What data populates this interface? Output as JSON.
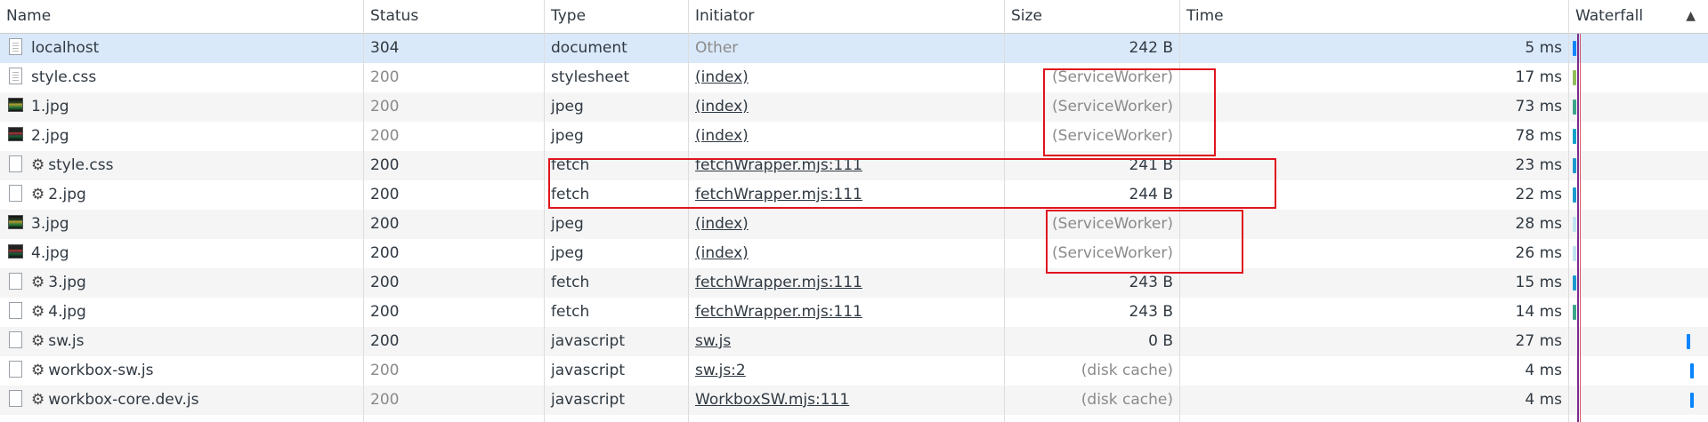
{
  "columns": {
    "name": "Name",
    "status": "Status",
    "type": "Type",
    "initiator": "Initiator",
    "size": "Size",
    "time": "Time",
    "waterfall": "Waterfall"
  },
  "rows": [
    {
      "name": "localhost",
      "icon": "document-icon",
      "gear": false,
      "status": "304",
      "status_muted": false,
      "type": "document",
      "initiator": "Other",
      "initiator_link": false,
      "size": "242 B",
      "size_muted": false,
      "time": "5 ms",
      "selected": true
    },
    {
      "name": "style.css",
      "icon": "document-icon",
      "gear": false,
      "status": "200",
      "status_muted": true,
      "type": "stylesheet",
      "initiator": "(index)",
      "initiator_link": true,
      "size": "(ServiceWorker)",
      "size_muted": true,
      "time": "17 ms"
    },
    {
      "name": "1.jpg",
      "icon": "image-icon",
      "gear": false,
      "status": "200",
      "status_muted": true,
      "type": "jpeg",
      "initiator": "(index)",
      "initiator_link": true,
      "size": "(ServiceWorker)",
      "size_muted": true,
      "time": "73 ms"
    },
    {
      "name": "2.jpg",
      "icon": "image-icon",
      "gear": false,
      "status": "200",
      "status_muted": true,
      "type": "jpeg",
      "initiator": "(index)",
      "initiator_link": true,
      "size": "(ServiceWorker)",
      "size_muted": true,
      "time": "78 ms"
    },
    {
      "name": "style.css",
      "icon": "file-icon",
      "gear": true,
      "status": "200",
      "status_muted": false,
      "type": "fetch",
      "initiator": "fetchWrapper.mjs:111",
      "initiator_link": true,
      "size": "241 B",
      "size_muted": false,
      "time": "23 ms"
    },
    {
      "name": "2.jpg",
      "icon": "file-icon",
      "gear": true,
      "status": "200",
      "status_muted": false,
      "type": "fetch",
      "initiator": "fetchWrapper.mjs:111",
      "initiator_link": true,
      "size": "244 B",
      "size_muted": false,
      "time": "22 ms"
    },
    {
      "name": "3.jpg",
      "icon": "image-icon",
      "gear": false,
      "status": "200",
      "status_muted": false,
      "type": "jpeg",
      "initiator": "(index)",
      "initiator_link": true,
      "size": "(ServiceWorker)",
      "size_muted": true,
      "time": "28 ms"
    },
    {
      "name": "4.jpg",
      "icon": "image-icon",
      "gear": false,
      "status": "200",
      "status_muted": false,
      "type": "jpeg",
      "initiator": "(index)",
      "initiator_link": true,
      "size": "(ServiceWorker)",
      "size_muted": true,
      "time": "26 ms"
    },
    {
      "name": "3.jpg",
      "icon": "file-icon",
      "gear": true,
      "status": "200",
      "status_muted": false,
      "type": "fetch",
      "initiator": "fetchWrapper.mjs:111",
      "initiator_link": true,
      "size": "243 B",
      "size_muted": false,
      "time": "15 ms"
    },
    {
      "name": "4.jpg",
      "icon": "file-icon",
      "gear": true,
      "status": "200",
      "status_muted": false,
      "type": "fetch",
      "initiator": "fetchWrapper.mjs:111",
      "initiator_link": true,
      "size": "243 B",
      "size_muted": false,
      "time": "14 ms"
    },
    {
      "name": "sw.js",
      "icon": "file-icon",
      "gear": true,
      "status": "200",
      "status_muted": false,
      "type": "javascript",
      "initiator": "sw.js",
      "initiator_link": true,
      "size": "0 B",
      "size_muted": false,
      "time": "27 ms"
    },
    {
      "name": "workbox-sw.js",
      "icon": "file-icon",
      "gear": true,
      "status": "200",
      "status_muted": true,
      "type": "javascript",
      "initiator": "sw.js:2",
      "initiator_link": true,
      "size": "(disk cache)",
      "size_muted": true,
      "time": "4 ms"
    },
    {
      "name": "workbox-core.dev.js",
      "icon": "file-icon",
      "gear": true,
      "status": "200",
      "status_muted": true,
      "type": "javascript",
      "initiator": "WorkboxSW.mjs:111",
      "initiator_link": true,
      "size": "(disk cache)",
      "size_muted": true,
      "time": "4 ms"
    }
  ],
  "gear_glyph": "⚙",
  "sort_glyph": "▲",
  "colors": {
    "selected_row": "#dae9f9",
    "alt_row": "#f5f5f5",
    "highlight_box": "#e0141e",
    "waterfall_line": "#7b2c8c"
  }
}
